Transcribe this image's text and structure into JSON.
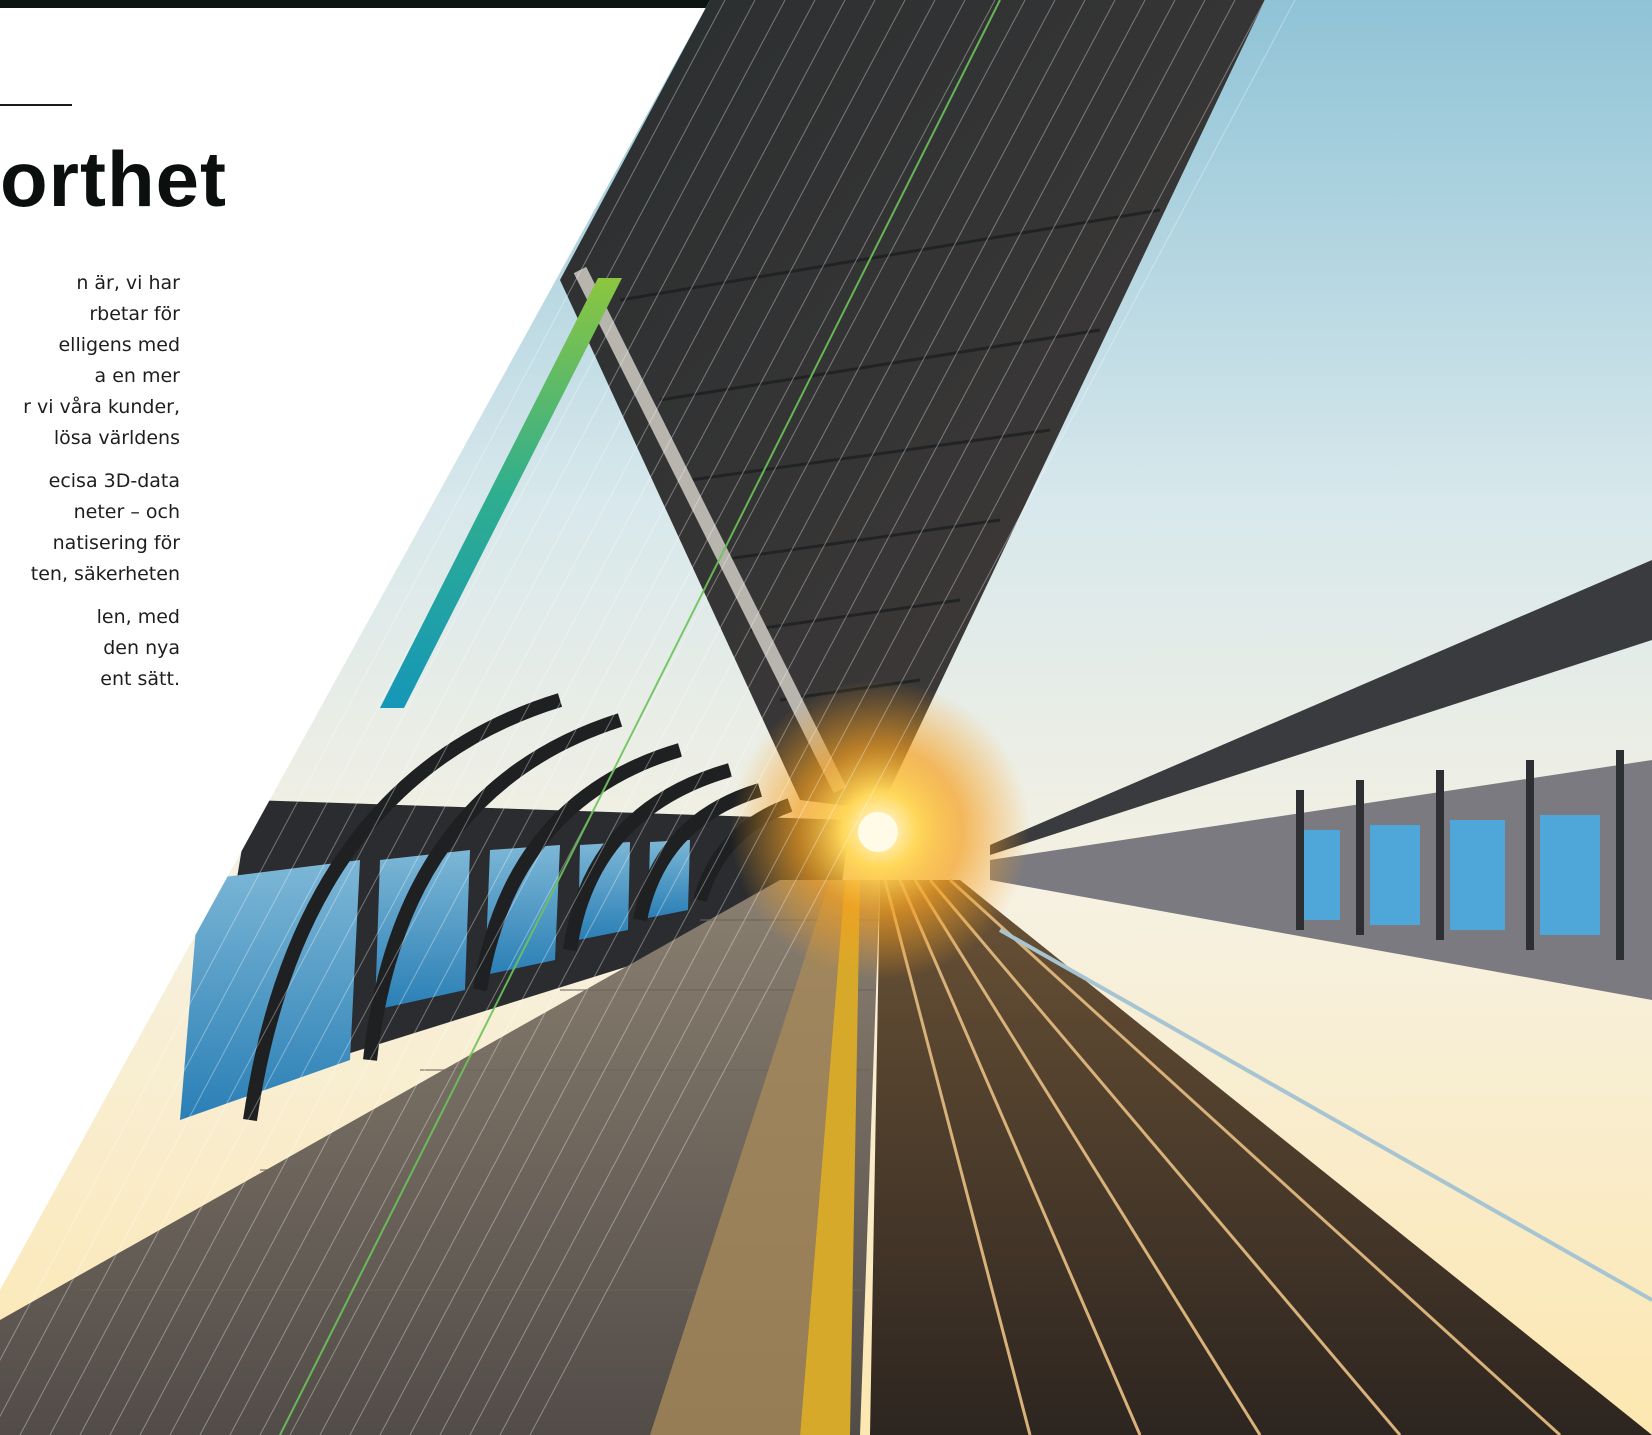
{
  "heading": "orthet",
  "paragraphs": [
    [
      "n är, vi har",
      "rbetar för",
      "elligens med",
      "a en mer",
      "r vi våra kunder,",
      "lösa världens"
    ],
    [
      "ecisa 3D-data",
      "neter – och",
      "natisering för",
      "ten, säkerheten"
    ],
    [
      "len, med",
      "den nya",
      "ent sätt."
    ]
  ],
  "colors": {
    "text": "#1e1e1e",
    "heading": "#0b0f0e",
    "accent_green": "#8cc63f",
    "accent_teal": "#14a3b0",
    "sky": "#eef3f4",
    "sun": "#ffc23a"
  },
  "image": {
    "subject": "elevated railway station platform at sunrise"
  }
}
